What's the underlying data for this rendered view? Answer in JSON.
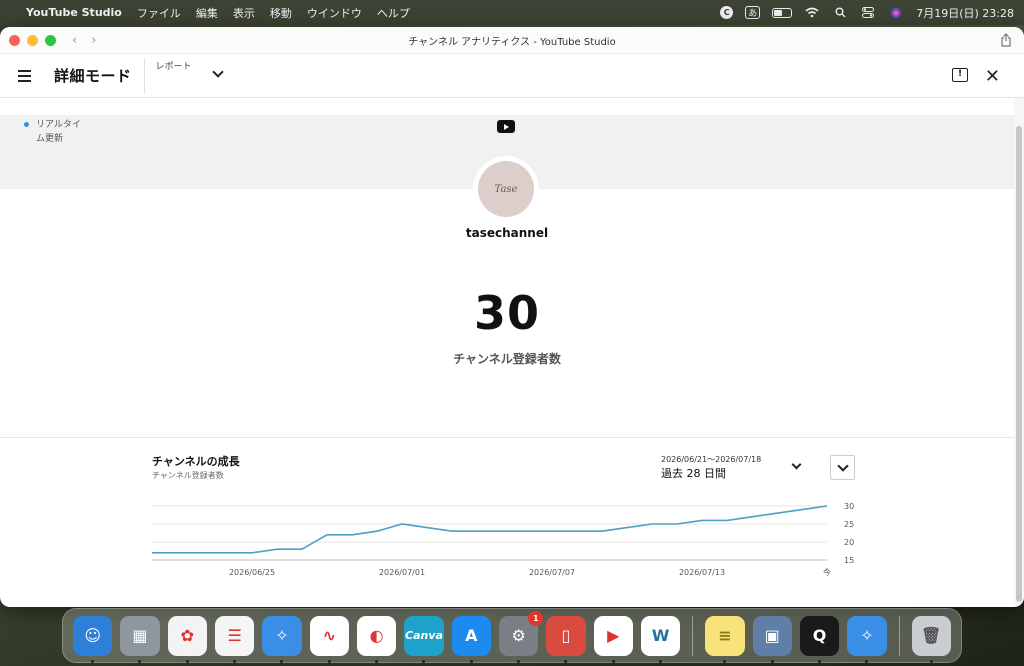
{
  "menubar": {
    "apple": "",
    "app_name": "YouTube Studio",
    "items": [
      "ファイル",
      "編集",
      "表示",
      "移動",
      "ウインドウ",
      "ヘルプ"
    ],
    "input_mode": "あ",
    "clock": "7月19日(日)  23:28"
  },
  "window": {
    "title": "チャンネル アナリティクス - YouTube Studio"
  },
  "appbar": {
    "title": "詳細モード",
    "report_label": "レポート"
  },
  "realtime": {
    "label": "リアルタイム更新"
  },
  "channel": {
    "name": "tasechannel",
    "avatar_text": "Tase",
    "subscribers": "30",
    "subscribers_label": "チャンネル登録者数"
  },
  "growth": {
    "title": "チャンネルの成長",
    "subtitle": "チャンネル登録者数",
    "date_range": "2026/06/21〜2026/07/18",
    "period": "過去 28 日間"
  },
  "chart_data": {
    "type": "line",
    "x": [
      "06/21",
      "06/22",
      "06/23",
      "06/24",
      "06/25",
      "06/26",
      "06/27",
      "06/28",
      "06/29",
      "06/30",
      "07/01",
      "07/02",
      "07/03",
      "07/04",
      "07/05",
      "07/06",
      "07/07",
      "07/08",
      "07/09",
      "07/10",
      "07/11",
      "07/12",
      "07/13",
      "07/14",
      "07/15",
      "07/16",
      "07/17",
      "07/18"
    ],
    "series": [
      {
        "values": [
          17,
          17,
          17,
          17,
          17,
          18,
          18,
          22,
          22,
          23,
          25,
          24,
          23,
          23,
          23,
          23,
          23,
          23,
          23,
          24,
          25,
          25,
          26,
          26,
          27,
          28,
          29,
          30
        ]
      }
    ],
    "ylim": [
      15,
      30
    ],
    "yticks": [
      15,
      20,
      25,
      30
    ],
    "xtick_labels": [
      "2026/06/25",
      "2026/07/01",
      "2026/07/07",
      "2026/07/13",
      "今"
    ],
    "xtick_index": [
      4,
      10,
      16,
      22,
      27
    ],
    "color": "#4f9ec8",
    "grid": true
  },
  "dock": {
    "apps": [
      {
        "name": "finder",
        "color": "#2d7fd8",
        "glyph": "☺"
      },
      {
        "name": "launchpad",
        "color": "#8e96a0",
        "glyph": "▦"
      },
      {
        "name": "photos",
        "color": "#f3f3f3",
        "glyph": "✿"
      },
      {
        "name": "reminders",
        "color": "#f5f5f5",
        "glyph": "☰"
      },
      {
        "name": "safari",
        "color": "#3a8ee6",
        "glyph": "✧"
      },
      {
        "name": "freeform",
        "color": "#ffffff",
        "glyph": "∿"
      },
      {
        "name": "fish-app",
        "color": "#ffffff",
        "glyph": "◐"
      },
      {
        "name": "canva",
        "color": "#1fa2c9",
        "glyph": "Canva"
      },
      {
        "name": "app-store",
        "color": "#1d8af0",
        "glyph": "A"
      },
      {
        "name": "system-settings",
        "color": "#7a7f86",
        "glyph": "⚙",
        "badge": "1"
      },
      {
        "name": "iphone-mirroring",
        "color": "#d94a3f",
        "glyph": "▯"
      },
      {
        "name": "youtube",
        "color": "#ffffff",
        "glyph": "▶"
      },
      {
        "name": "wordpress",
        "color": "#ffffff",
        "glyph": "W"
      }
    ],
    "apps_right": [
      {
        "name": "notes",
        "color": "#f8e27a",
        "glyph": "≡"
      },
      {
        "name": "preview",
        "color": "#5f7fa8",
        "glyph": "▣"
      },
      {
        "name": "quicktime",
        "color": "#1a1a1a",
        "glyph": "Q"
      },
      {
        "name": "safari-downloads",
        "color": "#3a8ee6",
        "glyph": "✧"
      }
    ],
    "trash": {
      "name": "trash",
      "color": "#c9ccd0",
      "glyph": "🗑"
    }
  }
}
